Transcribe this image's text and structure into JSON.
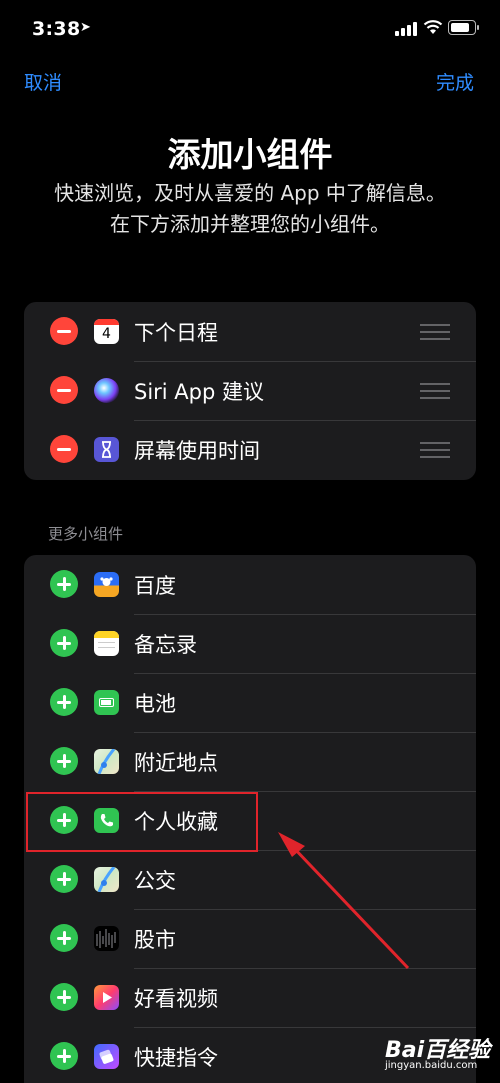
{
  "status": {
    "time": "3:38"
  },
  "nav": {
    "cancel": "取消",
    "done": "完成"
  },
  "header": {
    "title": "添加小组件",
    "subtitle": "快速浏览，及时从喜爱的 App 中了解信息。在下方添加并整理您的小组件。"
  },
  "active_widgets": [
    {
      "label": "下个日程",
      "icon": "calendar-icon"
    },
    {
      "label": "Siri App 建议",
      "icon": "siri-icon"
    },
    {
      "label": "屏幕使用时间",
      "icon": "hourglass-icon"
    }
  ],
  "more": {
    "section_title": "更多小组件",
    "items": [
      {
        "label": "百度",
        "icon": "baidu-icon"
      },
      {
        "label": "备忘录",
        "icon": "notes-icon"
      },
      {
        "label": "电池",
        "icon": "battery-app-icon"
      },
      {
        "label": "附近地点",
        "icon": "maps-icon"
      },
      {
        "label": "个人收藏",
        "icon": "phone-icon"
      },
      {
        "label": "公交",
        "icon": "maps-icon"
      },
      {
        "label": "股市",
        "icon": "stocks-icon"
      },
      {
        "label": "好看视频",
        "icon": "haokan-video-icon"
      },
      {
        "label": "快捷指令",
        "icon": "shortcuts-icon"
      }
    ]
  },
  "calendar_day": "4",
  "watermark": {
    "brand": "Bai百经验",
    "url": "jingyan.baidu.com"
  },
  "colors": {
    "accent": "#2f8cff",
    "remove": "#ff453a",
    "add": "#30c452",
    "card": "#1c1c1e",
    "highlight": "#e0242b"
  }
}
